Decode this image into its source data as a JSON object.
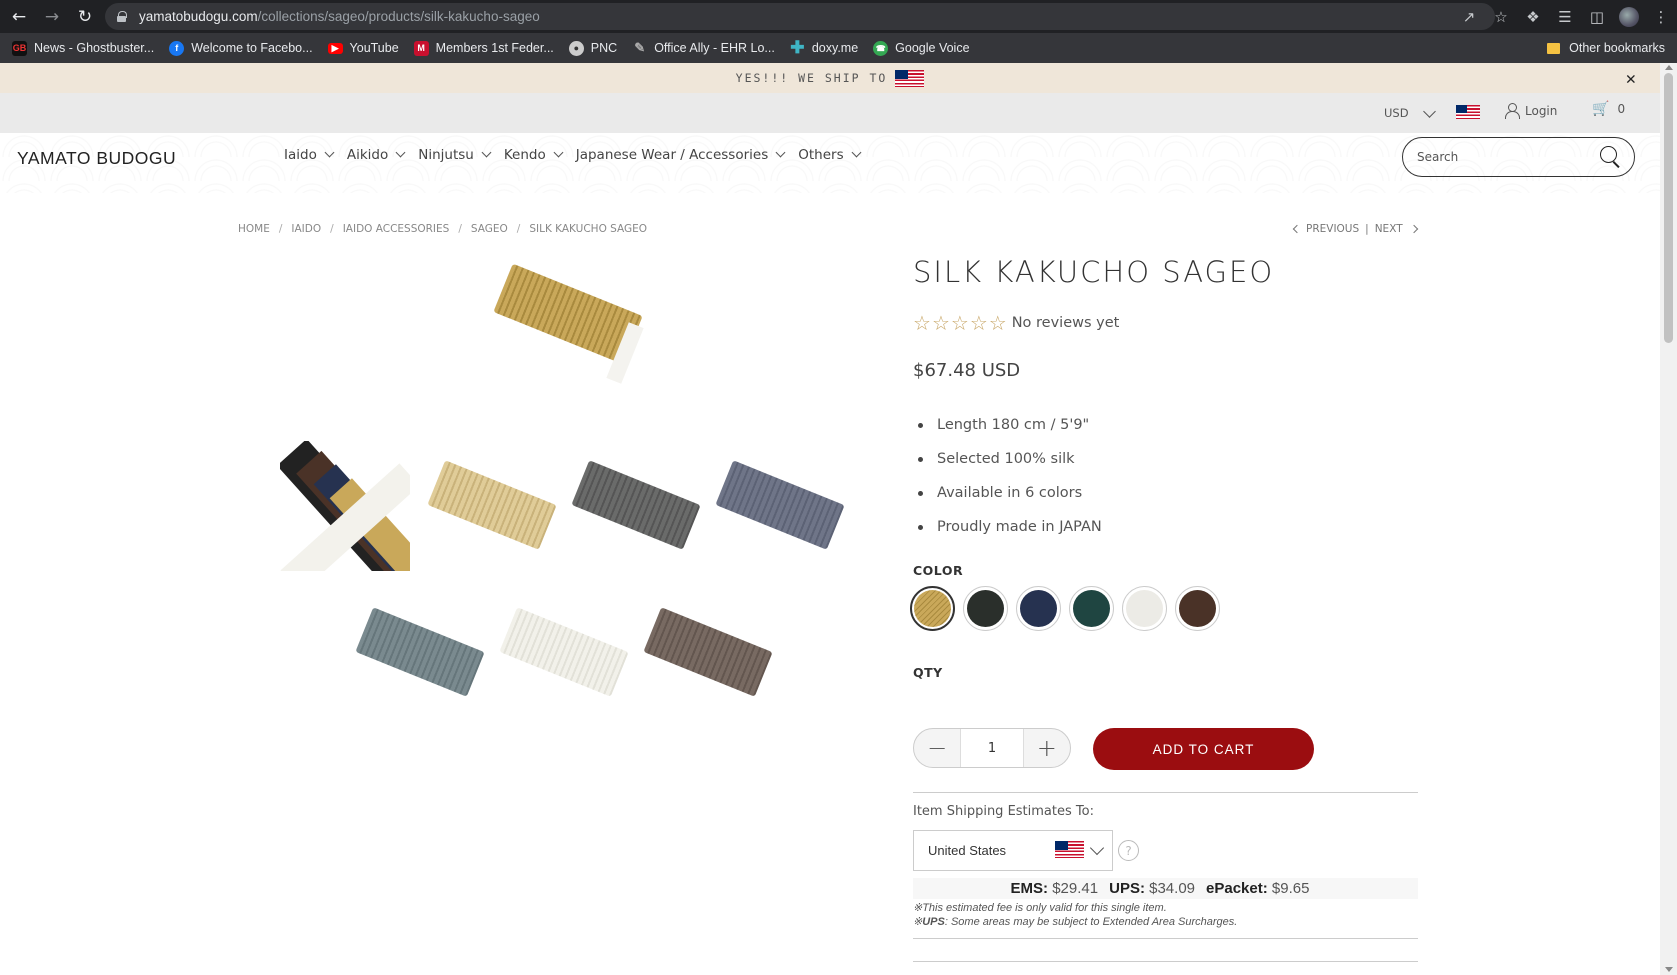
{
  "browser": {
    "url_host": "yamatobudogu.com",
    "url_path": "/collections/sageo/products/silk-kakucho-sageo",
    "bookmarks": [
      {
        "label": "News - Ghostbuster...",
        "icon": "ghostbuster-icon",
        "color": "#111111"
      },
      {
        "label": "Welcome to Facebo...",
        "icon": "facebook-icon",
        "color": "#1877f2"
      },
      {
        "label": "YouTube",
        "icon": "youtube-icon",
        "color": "#ff0000"
      },
      {
        "label": "Members 1st Feder...",
        "icon": "members1st-icon",
        "color": "#c8102e"
      },
      {
        "label": "PNC",
        "icon": "globe-icon",
        "color": "#5f6368"
      },
      {
        "label": "Office Ally - EHR Lo...",
        "icon": "office-ally-icon",
        "color": "#5f6368"
      },
      {
        "label": "doxy.me",
        "icon": "doxy-icon",
        "color": "#3fb5c5"
      },
      {
        "label": "Google Voice",
        "icon": "google-voice-icon",
        "color": "#34a853"
      }
    ],
    "other_bookmarks": "Other bookmarks"
  },
  "promo": {
    "text": "YES!!! WE SHIP TO"
  },
  "utility": {
    "currency": "USD",
    "login": "Login",
    "cart_count": "0"
  },
  "header": {
    "logo": "YAMATO BUDOGU",
    "nav": [
      "Iaido",
      "Aikido",
      "Ninjutsu",
      "Kendo",
      "Japanese Wear / Accessories",
      "Others"
    ],
    "search_placeholder": "Search"
  },
  "breadcrumb": [
    "HOME",
    "IAIDO",
    "IAIDO ACCESSORIES",
    "SAGEO",
    "SILK KAKUCHO SAGEO"
  ],
  "pager": {
    "previous": "PREVIOUS",
    "next": "NEXT"
  },
  "product": {
    "title": "SILK KAKUCHO SAGEO",
    "rating_stars": 0,
    "reviews": "No reviews yet",
    "price": "$67.48 USD",
    "features": [
      "Length 180 cm / 5'9\"",
      "Selected 100% silk",
      "Available in 6 colors",
      "Proudly made in JAPAN"
    ],
    "color_label": "COLOR",
    "colors": [
      {
        "name": "gold",
        "hex": "#c9a85a"
      },
      {
        "name": "black",
        "hex": "#2a2f2b"
      },
      {
        "name": "navy",
        "hex": "#263250"
      },
      {
        "name": "green",
        "hex": "#1f4541"
      },
      {
        "name": "white",
        "hex": "#ecebe6"
      },
      {
        "name": "brown",
        "hex": "#4a3227"
      }
    ],
    "qty_label": "QTY",
    "qty": "1",
    "add_to_cart": "ADD TO CART"
  },
  "shipping": {
    "label": "Item Shipping Estimates To:",
    "country": "United States",
    "rates": [
      {
        "carrier": "EMS:",
        "price": "$29.41"
      },
      {
        "carrier": "UPS:",
        "price": "$34.09"
      },
      {
        "carrier": "ePacket:",
        "price": "$9.65"
      }
    ],
    "note1": "※This estimated fee is only valid for this single item.",
    "note2_prefix": "※",
    "note2_bold": "UPS",
    "note2_rest": ": Some areas may be subject to Extended Area Surcharges."
  },
  "gallery": {
    "thumbnail_colors": [
      "#c9a85a",
      "#e0cc98",
      "#6a6b6a",
      "#6f7588",
      "#7a8a8f",
      "#f2f1ea",
      "#786a62"
    ]
  }
}
